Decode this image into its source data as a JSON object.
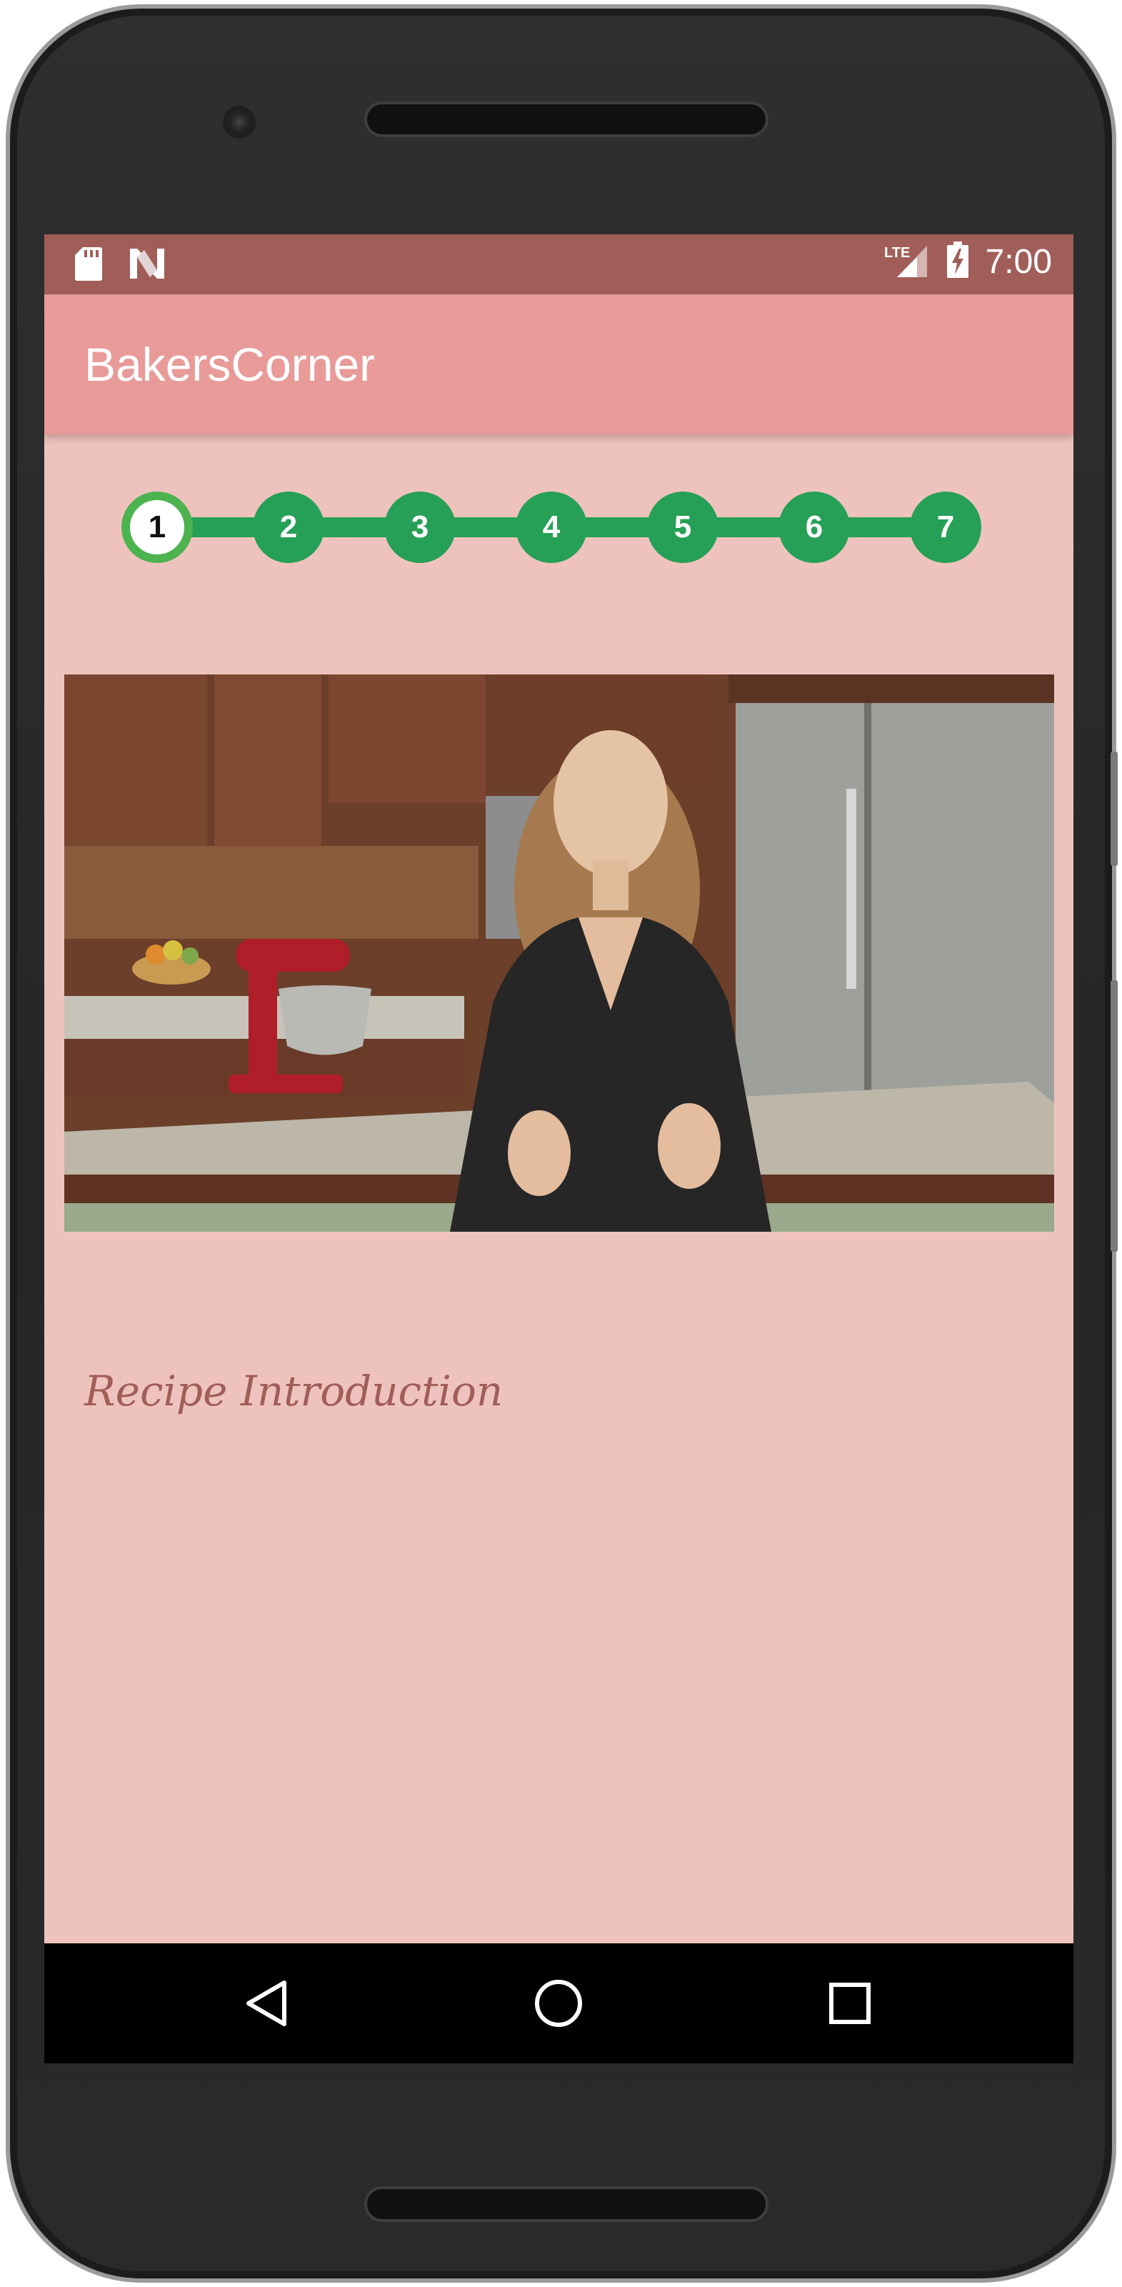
{
  "status_bar": {
    "time": "7:00",
    "network": "LTE",
    "icons": [
      "sd-card-icon",
      "n-logo-icon",
      "lte-signal-icon",
      "battery-charging-icon"
    ]
  },
  "app_bar": {
    "title": "BakersCorner"
  },
  "stepper": {
    "steps": [
      "1",
      "2",
      "3",
      "4",
      "5",
      "6",
      "7"
    ],
    "active_index": 0,
    "colors": {
      "step": "#26a056",
      "active_ring": "#4cb34f",
      "active_fill": "#ffffff"
    }
  },
  "video": {
    "content": "recipe-intro-video-frame"
  },
  "step_description": "Recipe Introduction",
  "nav_bar": {
    "buttons": [
      "back-icon",
      "home-icon",
      "recents-icon"
    ]
  },
  "colors": {
    "status_bar": "#a15e59",
    "app_bar": "#e89b98",
    "background": "#efc3bd",
    "description_text": "#a15e59"
  }
}
